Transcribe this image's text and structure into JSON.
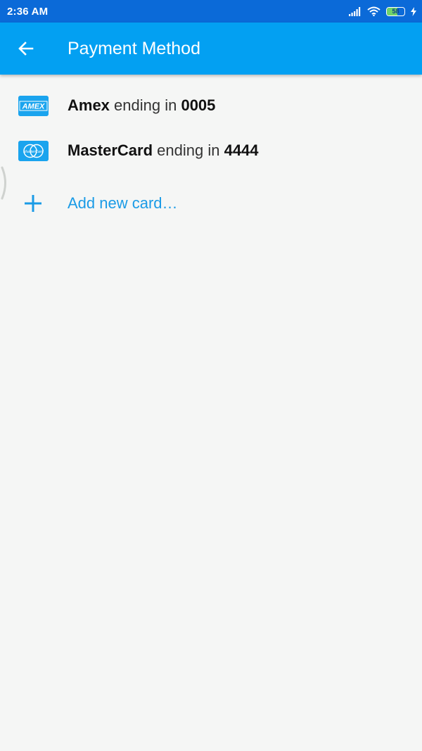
{
  "status_bar": {
    "time": "2:36 AM",
    "battery_level": "58",
    "battery_fraction": 0.58,
    "icons": [
      "signal-icon",
      "wifi-icon",
      "battery-icon",
      "charging-icon"
    ]
  },
  "header": {
    "title": "Payment Method",
    "back_icon": "arrow-left-icon"
  },
  "cards": [
    {
      "brand": "Amex",
      "middle": " ending in ",
      "last4": "0005",
      "logo_text": "AMEX",
      "icon": "amex-card-icon"
    },
    {
      "brand": "MasterCard",
      "middle": " ending in ",
      "last4": "4444",
      "logo_text": "MasterCard",
      "icon": "mastercard-card-icon"
    }
  ],
  "add_card": {
    "label": "Add new card…",
    "icon": "plus-icon"
  },
  "colors": {
    "status_bar": "#0b6ad8",
    "app_bar": "#03a0f2",
    "accent": "#1a9be6",
    "background": "#f5f6f5"
  }
}
